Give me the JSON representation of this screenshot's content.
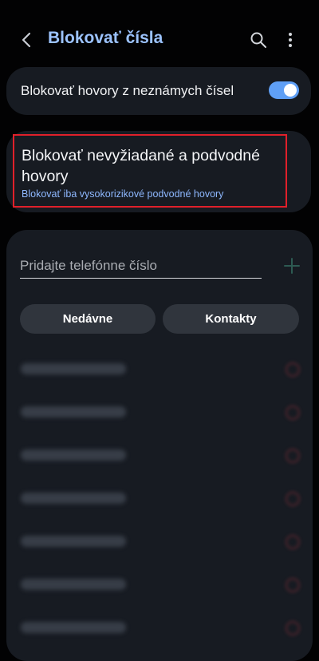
{
  "header": {
    "back_icon": "chevron-left-icon",
    "title": "Blokovať čísla",
    "search_icon": "search-icon",
    "more_icon": "more-vertical-icon"
  },
  "unknown_calls": {
    "label": "Blokovať hovory z neznámych čísel",
    "toggle_on": true,
    "toggle_color": "#5f9ff5"
  },
  "spam_calls": {
    "title": "Blokovať nevyžiadané a podvodné hovory",
    "subtitle": "Blokovať iba vysokorizikové podvodné hovory"
  },
  "blocked_list": {
    "input_placeholder": "Pridajte telefónne číslo",
    "input_value": "",
    "add_icon": "plus-icon",
    "recent_label": "Nedávne",
    "contacts_label": "Kontakty",
    "remove_icon": "minus-circle-icon",
    "row_count": 8
  },
  "colors": {
    "accent": "#9cc3ff",
    "subtitle": "#8eb8ff",
    "highlight": "#e0202a",
    "card": "#171b22"
  }
}
